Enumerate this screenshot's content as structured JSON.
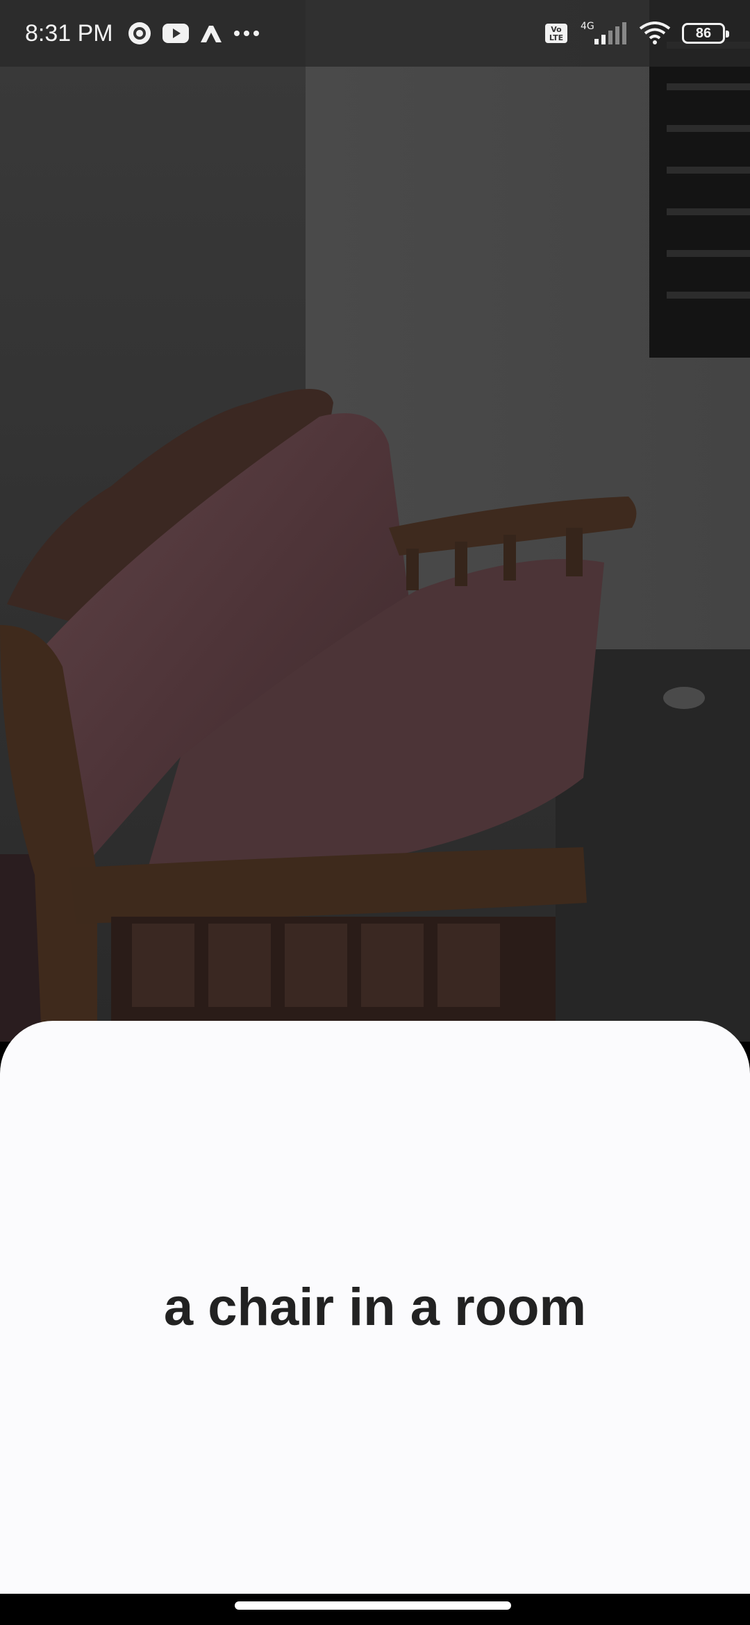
{
  "status_bar": {
    "time": "8:31 PM",
    "battery_level": "86",
    "network_type": "4G",
    "volte_label": "Vo LTE",
    "left_icons": [
      "camera-lens-icon",
      "youtube-icon",
      "arrow-app-icon",
      "more-dots-icon"
    ],
    "right_icons": [
      "volte-icon",
      "signal-icon",
      "wifi-icon",
      "battery-icon"
    ]
  },
  "background": {
    "image": "photo of a wooden sofa with plastic-covered cushions in a dim room"
  },
  "result": {
    "caption": "a chair in a room"
  },
  "colors": {
    "sheet_background": "#fbfbfd",
    "caption_text": "#222222",
    "status_bar_bg": "#282828"
  }
}
